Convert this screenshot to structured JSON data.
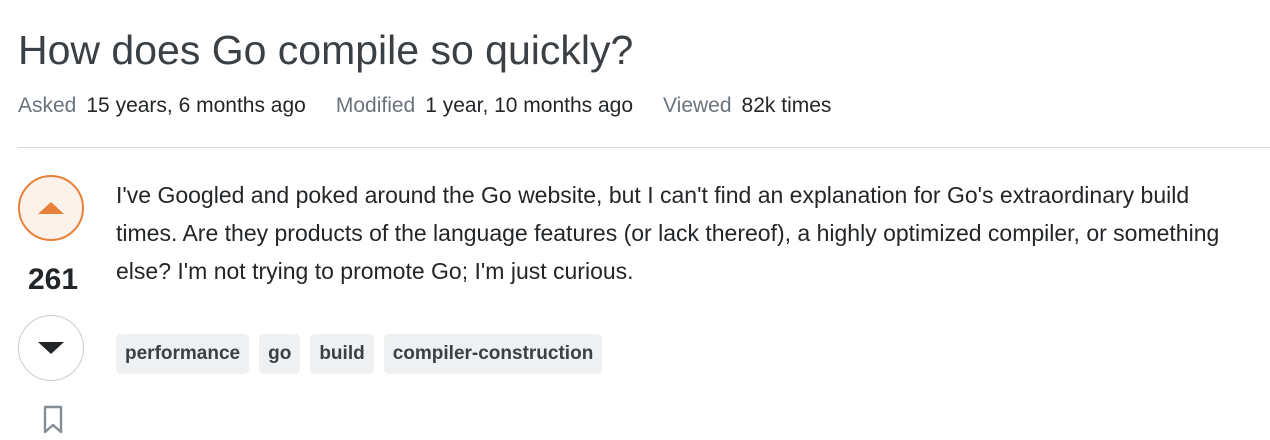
{
  "question": {
    "title": "How does Go compile so quickly?",
    "meta": {
      "asked_label": "Asked",
      "asked_value": "15 years, 6 months ago",
      "modified_label": "Modified",
      "modified_value": "1 year, 10 months ago",
      "viewed_label": "Viewed",
      "viewed_value": "82k times"
    },
    "votes": {
      "count": "261",
      "upvote_icon": "caret-up-icon",
      "downvote_icon": "caret-down-icon",
      "bookmark_icon": "bookmark-icon"
    },
    "body": "I've Googled and poked around the Go website, but I can't find an explanation for Go's extraordinary build times. Are they products of the language features (or lack thereof), a highly optimized compiler, or something else? I'm not trying to promote Go; I'm just curious.",
    "tags": [
      "performance",
      "go",
      "build",
      "compiler-construction"
    ]
  },
  "colors": {
    "upvote_accent": "#e7813a",
    "upvote_background": "#fdf2e9",
    "tag_background": "#eff0f2",
    "divider": "#d6d9dc"
  }
}
